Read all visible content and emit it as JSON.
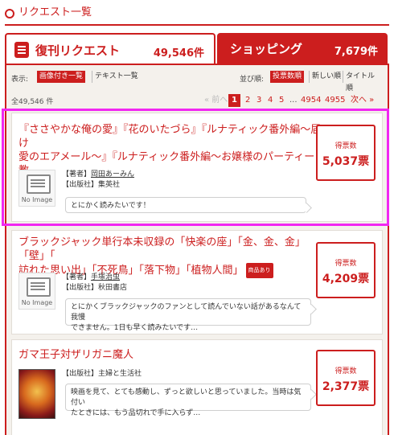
{
  "header": {
    "title": "リクエスト一覧"
  },
  "tabs": {
    "revival": {
      "label": "復刊リクエスト",
      "count": "49,546件"
    },
    "shopping": {
      "label": "ショッピング",
      "count": "7,679件"
    }
  },
  "view": {
    "label": "表示:",
    "with_image": "画像付き一覧",
    "text_only": "テキスト一覧",
    "sort_label": "並び順:",
    "sort_votes": "投票数順",
    "sort_new": "新しい順",
    "sort_title": "タイトル順"
  },
  "result_count": "全49,546 件",
  "pager": {
    "prev": "« 前へ",
    "current": "1",
    "p2": "2",
    "p3": "3",
    "p4": "4",
    "p5": "5",
    "ellipsis": "...",
    "p4954": "4954",
    "p4955": "4955",
    "next": "次へ »"
  },
  "items": [
    {
      "title_l1": "『ささやかな俺の愛』『花のいたづら』『ルナティック番外編～届け",
      "title_l2": "愛のエアメール～』『ルナティック番外編～お嬢様のパーティー教",
      "title_l3": "室～』",
      "author_label": "【著者】",
      "author": "岡田あーみん",
      "publisher_label": "【出版社】",
      "publisher": "集英社",
      "comment": "とにかく読みたいです！",
      "no_image": "No Image",
      "vote_label": "得票数",
      "votes": "5,037票"
    },
    {
      "title_l1": "ブラックジャック単行本未収録の「快楽の座」「金、金、金」「壁」「",
      "title_l2": "訪れた思い出」「不死鳥」「落下物」「植物人間」",
      "badge": "商品あり",
      "author_label": "【著者】",
      "author": "手塚治虫",
      "publisher_label": "【出版社】",
      "publisher": "秋田書店",
      "comment_l1": "とにかくブラックジャックのファンとして読んでいない話があるなんて我慢",
      "comment_l2": "できません。1日も早く読みたいです…",
      "no_image": "No Image",
      "vote_label": "得票数",
      "votes": "4,209票"
    },
    {
      "title_l1": "ガマ王子対ザリガニ魔人",
      "publisher_label": "【出版社】",
      "publisher": "主婦と生活社",
      "comment_l1": "映画を見て、とても感動し、ずっと欲しいと思っていました。当時は気付い",
      "comment_l2": "たときには、もう品切れで手に入らず…",
      "vote_label": "得票数",
      "votes": "2,377票"
    }
  ]
}
